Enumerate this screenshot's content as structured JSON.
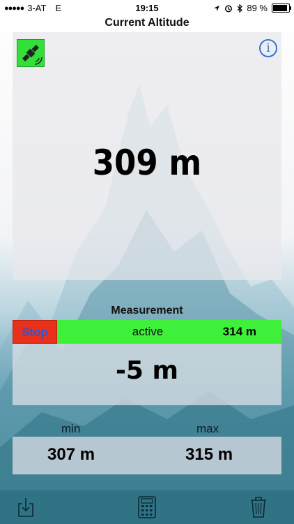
{
  "status_bar": {
    "carrier": "3-AT",
    "network": "E",
    "time": "19:15",
    "battery": "89 %",
    "battery_level": 0.89
  },
  "nav": {
    "title": "Current Altitude"
  },
  "altitude": {
    "value": "309 m"
  },
  "icons": {
    "satellite": "satellite-icon",
    "info": "info-icon",
    "export": "export-icon",
    "calculator": "calculator-icon",
    "trash": "trash-icon"
  },
  "info_glyph": "i",
  "measurement": {
    "title": "Measurement",
    "stop_label": "Stop",
    "status": "active",
    "start_value": "314 m",
    "delta": "-5 m"
  },
  "stats": {
    "min_label": "min",
    "max_label": "max",
    "min_value": "307 m",
    "max_value": "315 m"
  },
  "colors": {
    "accent_green": "#3ef03a",
    "stop_red": "#e8301a",
    "toolbar": "#2f7385",
    "info_blue": "#2f78d6"
  }
}
